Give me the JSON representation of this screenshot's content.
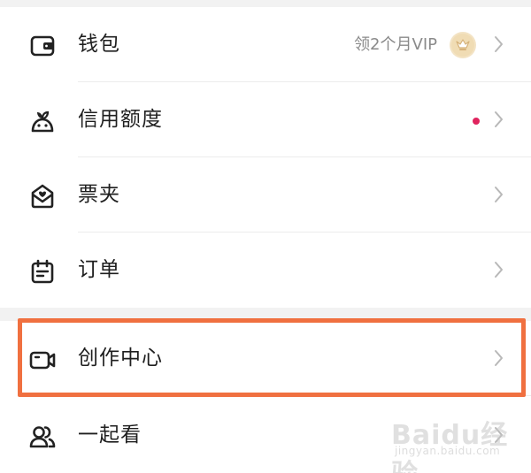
{
  "menu": {
    "group1": [
      {
        "label": "钱包",
        "icon": "wallet-icon",
        "promo": "领2个月VIP",
        "badge": "vip-crown-icon"
      },
      {
        "label": "信用额度",
        "icon": "credit-plant-icon",
        "badge_color": "#e0245e"
      },
      {
        "label": "票夹",
        "icon": "ticket-folder-icon"
      },
      {
        "label": "订单",
        "icon": "order-calendar-icon"
      }
    ],
    "group2": [
      {
        "label": "创作中心",
        "icon": "video-camera-icon"
      },
      {
        "label": "一起看",
        "icon": "users-icon"
      }
    ]
  },
  "highlight_color": "#f07040",
  "watermark": {
    "main": "Baidu经验",
    "sub": "jingyan.baidu.com"
  }
}
